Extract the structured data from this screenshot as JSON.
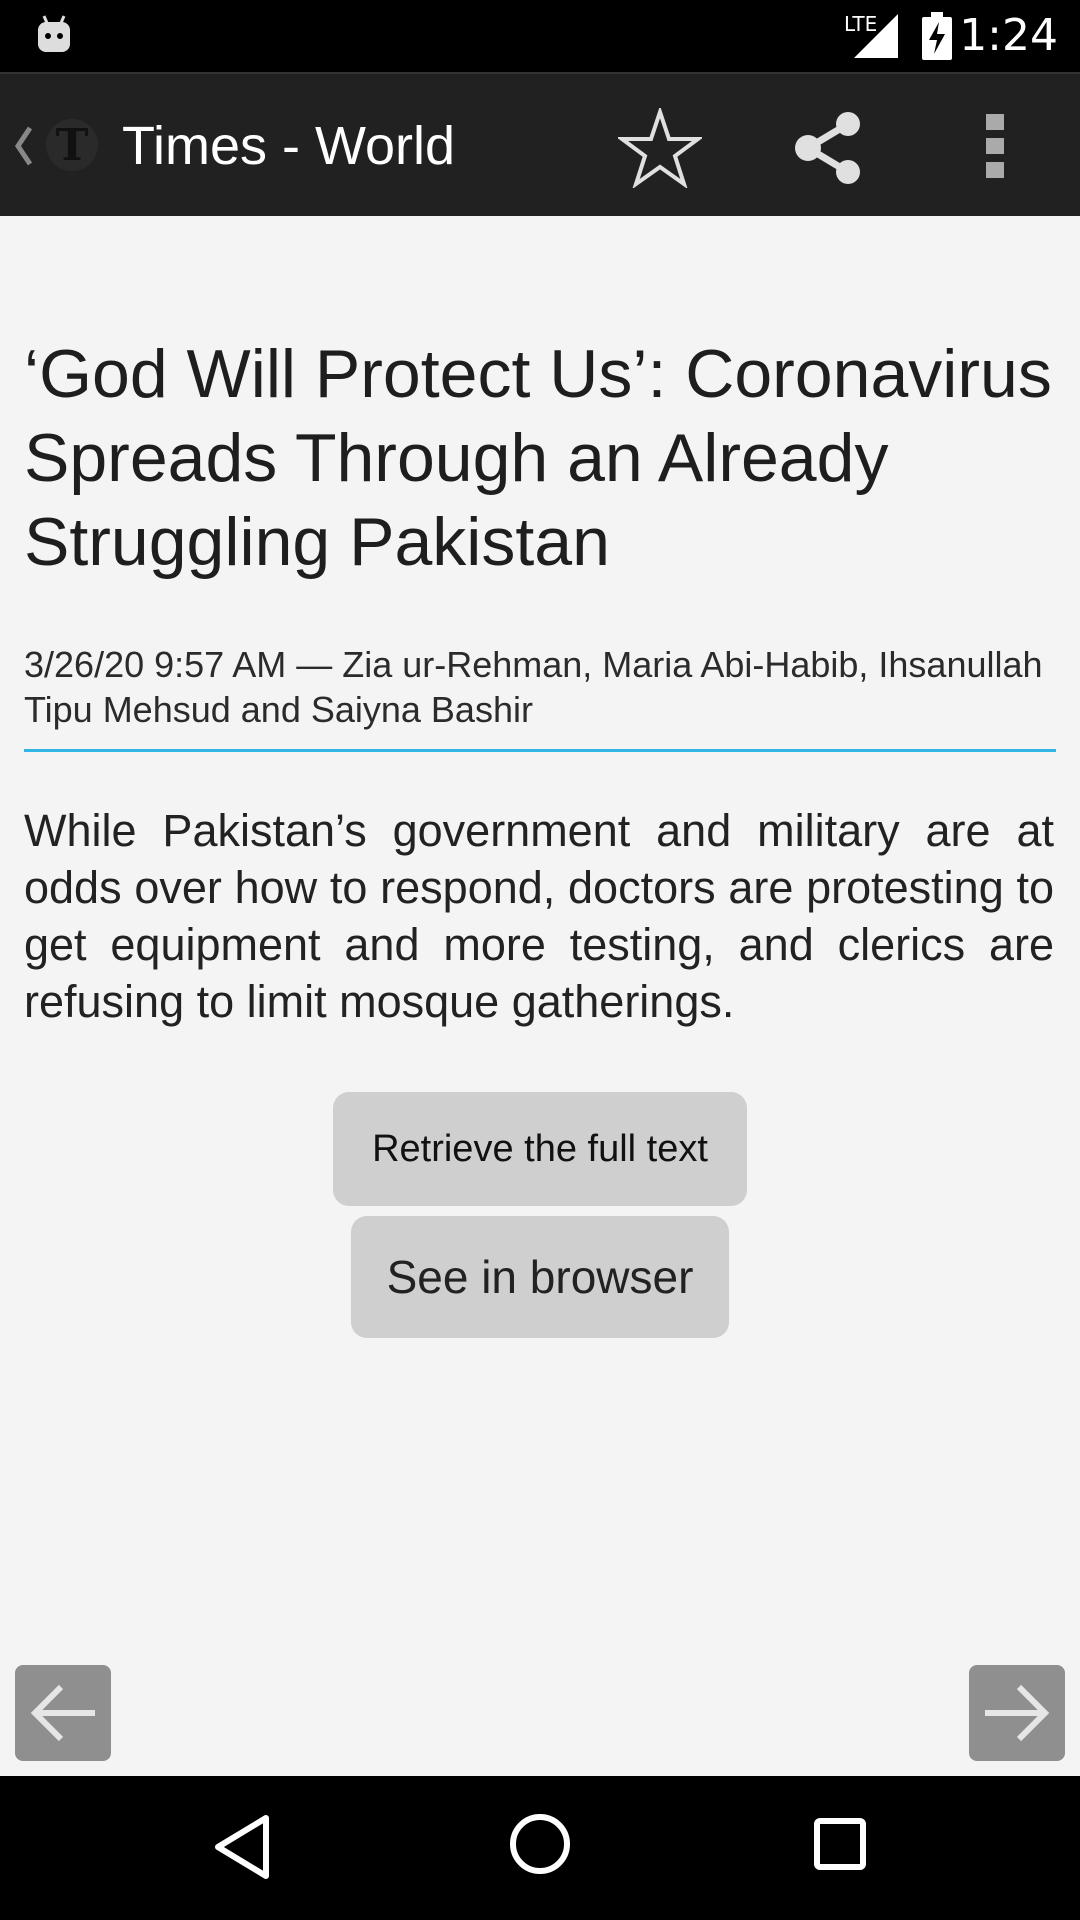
{
  "status_bar": {
    "time": "1:24",
    "network": "LTE",
    "icons": [
      "android-notification-icon",
      "signal-icon",
      "battery-charging-icon"
    ]
  },
  "app_bar": {
    "title": "Times - World",
    "icons": [
      "back-chevron-icon",
      "nyt-logo-icon",
      "star-icon",
      "share-icon",
      "overflow-menu-icon"
    ]
  },
  "article": {
    "headline": "‘God Will Protect Us’: Coronavirus Spreads Through an Already Struggling Pakistan",
    "meta": "3/26/20 9:57 AM — Zia ur-Rehman, Maria Abi-Habib, Ihsanullah Tipu Mehsud and Saiyna Bashir",
    "summary": "While Pakistan’s government and military are at odds over how to respond, doctors are protesting to get equipment and more testing, and clerics are refusing to limit mosque gatherings."
  },
  "buttons": {
    "full_text": "Retrieve the full text",
    "browser": "See in browser"
  },
  "nav": {
    "prev_icon": "arrow-left-icon",
    "next_icon": "arrow-right-icon"
  },
  "system_nav": {
    "icons": [
      "back-triangle-icon",
      "home-circle-icon",
      "recents-square-icon"
    ]
  },
  "colors": {
    "accent": "#33b5e5",
    "app_bar": "#212121",
    "background": "#f4f4f4",
    "button": "#cfcfcf"
  }
}
